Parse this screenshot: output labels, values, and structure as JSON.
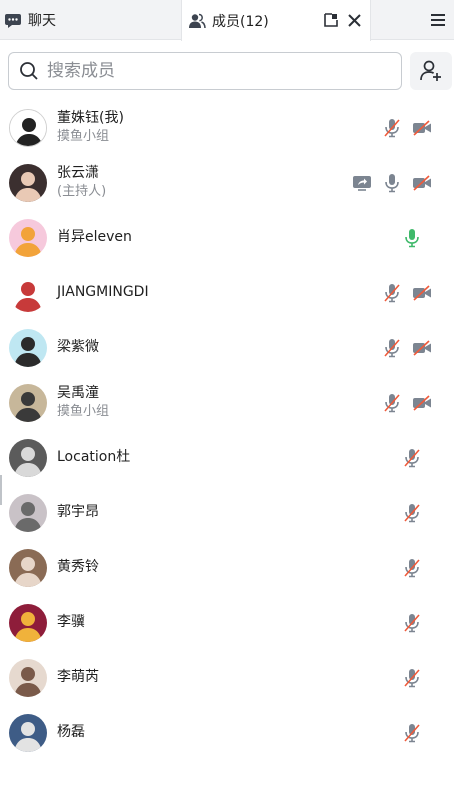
{
  "tabs": {
    "chat_label": "聊天",
    "members_label": "成员(12)"
  },
  "search": {
    "placeholder": "搜索成员"
  },
  "colors": {
    "muted_red": "#f05a3a",
    "icon_gray": "#7c8591",
    "mic_green": "#3fb96a"
  },
  "members": [
    {
      "name": "董姝钰(我)",
      "sub": "摸鱼小组",
      "share": false,
      "mic": "muted",
      "cam": "off"
    },
    {
      "name": "张云潇",
      "sub": "(主持人)",
      "share": true,
      "mic": "on",
      "cam": "off"
    },
    {
      "name": "肖异eleven",
      "sub": "",
      "share": false,
      "mic": "active",
      "cam": "none"
    },
    {
      "name": "JIANGMINGDI",
      "sub": "",
      "share": false,
      "mic": "muted",
      "cam": "off"
    },
    {
      "name": "梁紫微",
      "sub": "",
      "share": false,
      "mic": "muted",
      "cam": "off"
    },
    {
      "name": "吴禹潼",
      "sub": "摸鱼小组",
      "share": false,
      "mic": "muted",
      "cam": "off"
    },
    {
      "name": "Location杜",
      "sub": "",
      "share": false,
      "mic": "muted",
      "cam": "none"
    },
    {
      "name": "郭宇昂",
      "sub": "",
      "share": false,
      "mic": "muted",
      "cam": "none"
    },
    {
      "name": "黄秀铃",
      "sub": "",
      "share": false,
      "mic": "muted",
      "cam": "none"
    },
    {
      "name": "李骥",
      "sub": "",
      "share": false,
      "mic": "muted",
      "cam": "none"
    },
    {
      "name": "李萌芮",
      "sub": "",
      "share": false,
      "mic": "muted",
      "cam": "none"
    },
    {
      "name": "杨磊",
      "sub": "",
      "share": false,
      "mic": "muted",
      "cam": "none"
    }
  ]
}
